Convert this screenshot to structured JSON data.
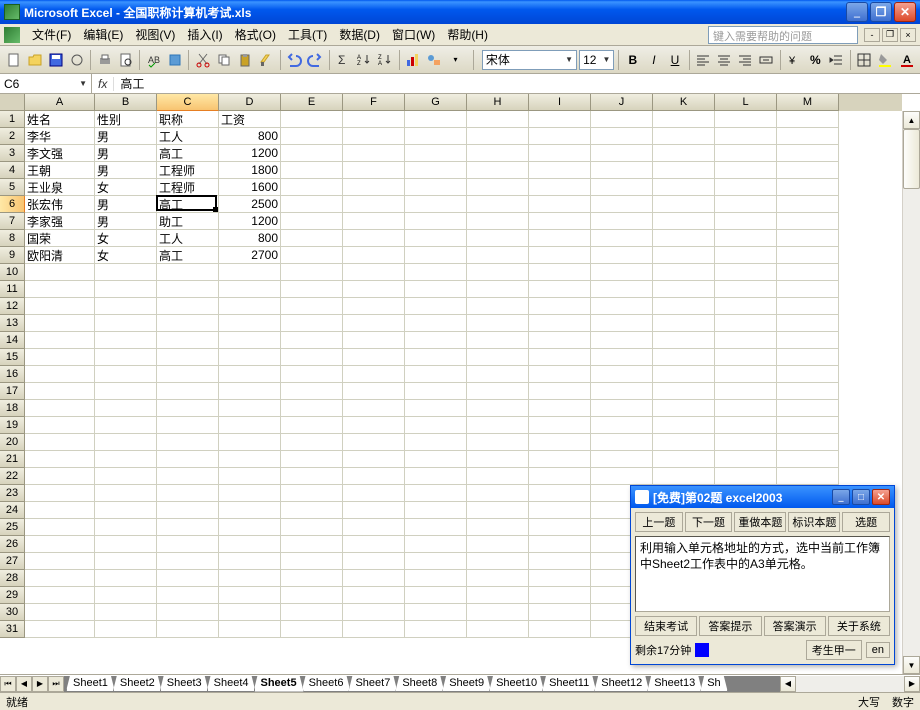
{
  "title": "Microsoft Excel - 全国职称计算机考试.xls",
  "menu": {
    "file": "文件(F)",
    "edit": "编辑(E)",
    "view": "视图(V)",
    "insert": "插入(I)",
    "format": "格式(O)",
    "tools": "工具(T)",
    "data": "数据(D)",
    "window": "窗口(W)",
    "help": "帮助(H)"
  },
  "help_placeholder": "键入需要帮助的问题",
  "font": {
    "name": "宋体",
    "size": "12"
  },
  "formula": {
    "name_box": "C6",
    "fx": "fx",
    "value": "高工"
  },
  "col_widths": {
    "A": 70,
    "B": 62,
    "C": 62,
    "D": 62,
    "default": 62
  },
  "columns": [
    "A",
    "B",
    "C",
    "D",
    "E",
    "F",
    "G",
    "H",
    "I",
    "J",
    "K",
    "L",
    "M"
  ],
  "sel": {
    "row": 6,
    "col": "C"
  },
  "rows": [
    {
      "n": 1,
      "A": "姓名",
      "B": "性别",
      "C": "职称",
      "D": "工资"
    },
    {
      "n": 2,
      "A": "李华",
      "B": "男",
      "C": "工人",
      "Dn": "800"
    },
    {
      "n": 3,
      "A": "李文强",
      "B": "男",
      "C": "高工",
      "Dn": "1200"
    },
    {
      "n": 4,
      "A": "王朝",
      "B": "男",
      "C": "工程师",
      "Dn": "1800"
    },
    {
      "n": 5,
      "A": "王业泉",
      "B": "女",
      "C": "工程师",
      "Dn": "1600"
    },
    {
      "n": 6,
      "A": "张宏伟",
      "B": "男",
      "C": "高工",
      "Dn": "2500"
    },
    {
      "n": 7,
      "A": "李家强",
      "B": "男",
      "C": "助工",
      "Dn": "1200"
    },
    {
      "n": 8,
      "A": "国荣",
      "B": "女",
      "C": "工人",
      "Dn": "800"
    },
    {
      "n": 9,
      "A": "欧阳清",
      "B": "女",
      "C": "高工",
      "Dn": "2700"
    }
  ],
  "total_rows": 31,
  "sheets": [
    "Sheet1",
    "Sheet2",
    "Sheet3",
    "Sheet4",
    "Sheet5",
    "Sheet6",
    "Sheet7",
    "Sheet8",
    "Sheet9",
    "Sheet10",
    "Sheet11",
    "Sheet12",
    "Sheet13",
    "Sh"
  ],
  "active_sheet": "Sheet5",
  "status": {
    "ready": "就绪",
    "caps": "大写",
    "num": "数字"
  },
  "exam": {
    "title": "[免费]第02题 excel2003",
    "prev": "上一题",
    "next": "下一题",
    "redo": "重做本题",
    "mark": "标识本题",
    "pick": "选题",
    "question": "利用输入单元格地址的方式，选中当前工作簿中Sheet2工作表中的A3单元格。",
    "end": "结束考试",
    "hint": "答案提示",
    "demo": "答案演示",
    "about": "关于系统",
    "remain": "剩余17分钟",
    "candidate": "考生甲一",
    "lang": "en"
  }
}
